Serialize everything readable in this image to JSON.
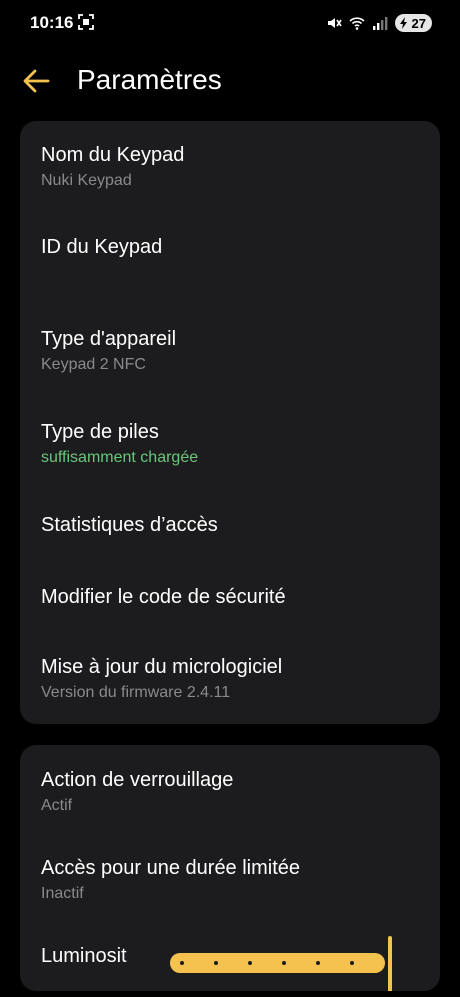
{
  "status_bar": {
    "time": "10:16",
    "battery": "27",
    "icons": [
      "screenshot-icon",
      "mute-icon",
      "wifi-icon",
      "signal-icon",
      "battery-charging-icon"
    ]
  },
  "header": {
    "back_icon": "back-arrow-icon",
    "title": "Paramètres",
    "accent_color": "#f5c24f"
  },
  "settings_group_1": {
    "items": [
      {
        "label": "Nom du Keypad",
        "value": "Nuki Keypad"
      },
      {
        "label": "ID du Keypad",
        "value": ""
      },
      {
        "label": "Type d'appareil",
        "value": "Keypad 2 NFC"
      },
      {
        "label": "Type de piles",
        "value": "suffisamment chargée",
        "value_color": "#69c77b"
      },
      {
        "label": "Statistiques d’accès"
      },
      {
        "label": "Modifier le code de sécurité"
      },
      {
        "label": "Mise à jour du micrologiciel",
        "value": "Version du firmware 2.4.11"
      }
    ]
  },
  "settings_group_2": {
    "items": [
      {
        "label": "Action de verrouillage",
        "value": "Actif"
      },
      {
        "label": "Accès pour une durée limitée",
        "value": "Inactif"
      },
      {
        "label": "Luminosit"
      }
    ],
    "brightness_slider": {
      "level": 1.0,
      "steps": 6
    }
  }
}
